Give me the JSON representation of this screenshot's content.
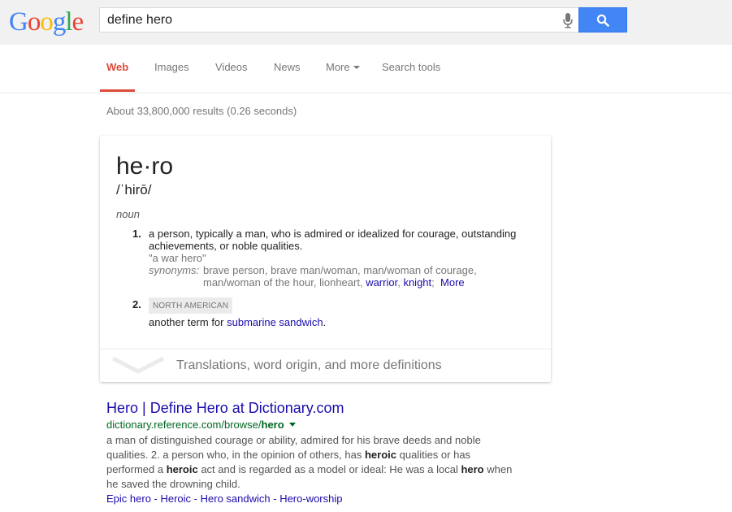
{
  "header": {
    "logo_letters": [
      {
        "ch": "G",
        "color": "#4285f4"
      },
      {
        "ch": "o",
        "color": "#ea4335"
      },
      {
        "ch": "o",
        "color": "#fbbc05"
      },
      {
        "ch": "g",
        "color": "#4285f4"
      },
      {
        "ch": "l",
        "color": "#34a853"
      },
      {
        "ch": "e",
        "color": "#ea4335"
      }
    ],
    "search_value": "define hero",
    "mic_icon": "microphone-icon",
    "search_icon": "magnifier-icon"
  },
  "nav": {
    "tabs": [
      {
        "label": "Web",
        "active": true
      },
      {
        "label": "Images"
      },
      {
        "label": "Videos"
      },
      {
        "label": "News"
      },
      {
        "label": "More"
      },
      {
        "label": "Search tools"
      }
    ],
    "accent_color": "#dd4b39"
  },
  "stats": "About 33,800,000 results (0.26 seconds)",
  "dictionary": {
    "word": "he·ro",
    "pronunciation": "/ˈhirō/",
    "part_of_speech": "noun",
    "senses": [
      {
        "num": "1.",
        "definition": "a person, typically a man, who is admired or idealized for courage, outstanding achievements, or noble qualities.",
        "example": "\"a war hero\"",
        "synonyms_label": "synonyms:",
        "synonyms_line1": "brave person, brave man/woman, man/woman of courage,",
        "synonyms_line2": "man/woman of the hour, lionheart,",
        "synonym_links": [
          "warrior",
          "knight"
        ],
        "more_label": "More"
      },
      {
        "num": "2.",
        "tag": "NORTH AMERICAN",
        "definition_prefix": "another term for",
        "definition_link": "submarine sandwich",
        "definition_suffix": "."
      }
    ],
    "footer_text": "Translations, word origin, and more definitions"
  },
  "result": {
    "title": "Hero | Define Hero at Dictionary.com",
    "url_prefix": "dictionary.reference.com/browse/",
    "url_bold": "hero",
    "snippet_parts": [
      {
        "t": "a man of distinguished courage or ability, admired for his brave deeds and noble qualities. 2. a person who, in the opinion of others, has "
      },
      {
        "b": "heroic"
      },
      {
        "t": " qualities or has performed a "
      },
      {
        "b": "heroic"
      },
      {
        "t": " act and is regarded as a model or ideal: He was a local "
      },
      {
        "b": "hero"
      },
      {
        "t": " when he saved the drowning child."
      }
    ],
    "sitelinks": [
      "Epic hero",
      "Heroic",
      "Hero sandwich",
      "Hero-worship"
    ],
    "sitelink_separator": " - "
  }
}
